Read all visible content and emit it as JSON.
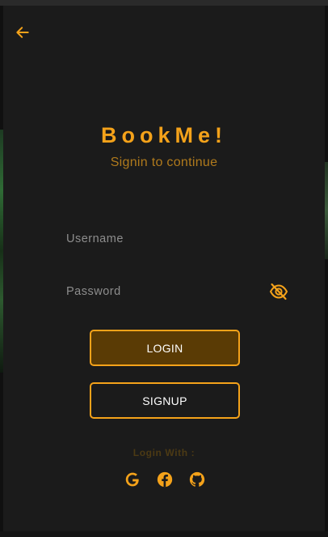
{
  "app": {
    "title": "BookMe!",
    "subtitle": "Signin to continue"
  },
  "form": {
    "username_placeholder": "Username",
    "username_value": "",
    "password_placeholder": "Password",
    "password_value": ""
  },
  "buttons": {
    "login_label": "LOGIN",
    "signup_label": "SIGNUP"
  },
  "social": {
    "heading": "Login With :",
    "providers": [
      {
        "name": "Google",
        "icon": "google-icon"
      },
      {
        "name": "Facebook",
        "icon": "facebook-icon"
      },
      {
        "name": "GitHub",
        "icon": "github-icon"
      }
    ]
  },
  "icons": {
    "back": "arrow-left-icon",
    "password_toggle": "eye-slash-icon"
  },
  "colors": {
    "accent": "#f4a21a",
    "background": "#1b1b1b",
    "login_button_fill": "#5a3b05",
    "subtitle": "#b07a1c",
    "muted_heading": "#4c3a14"
  }
}
